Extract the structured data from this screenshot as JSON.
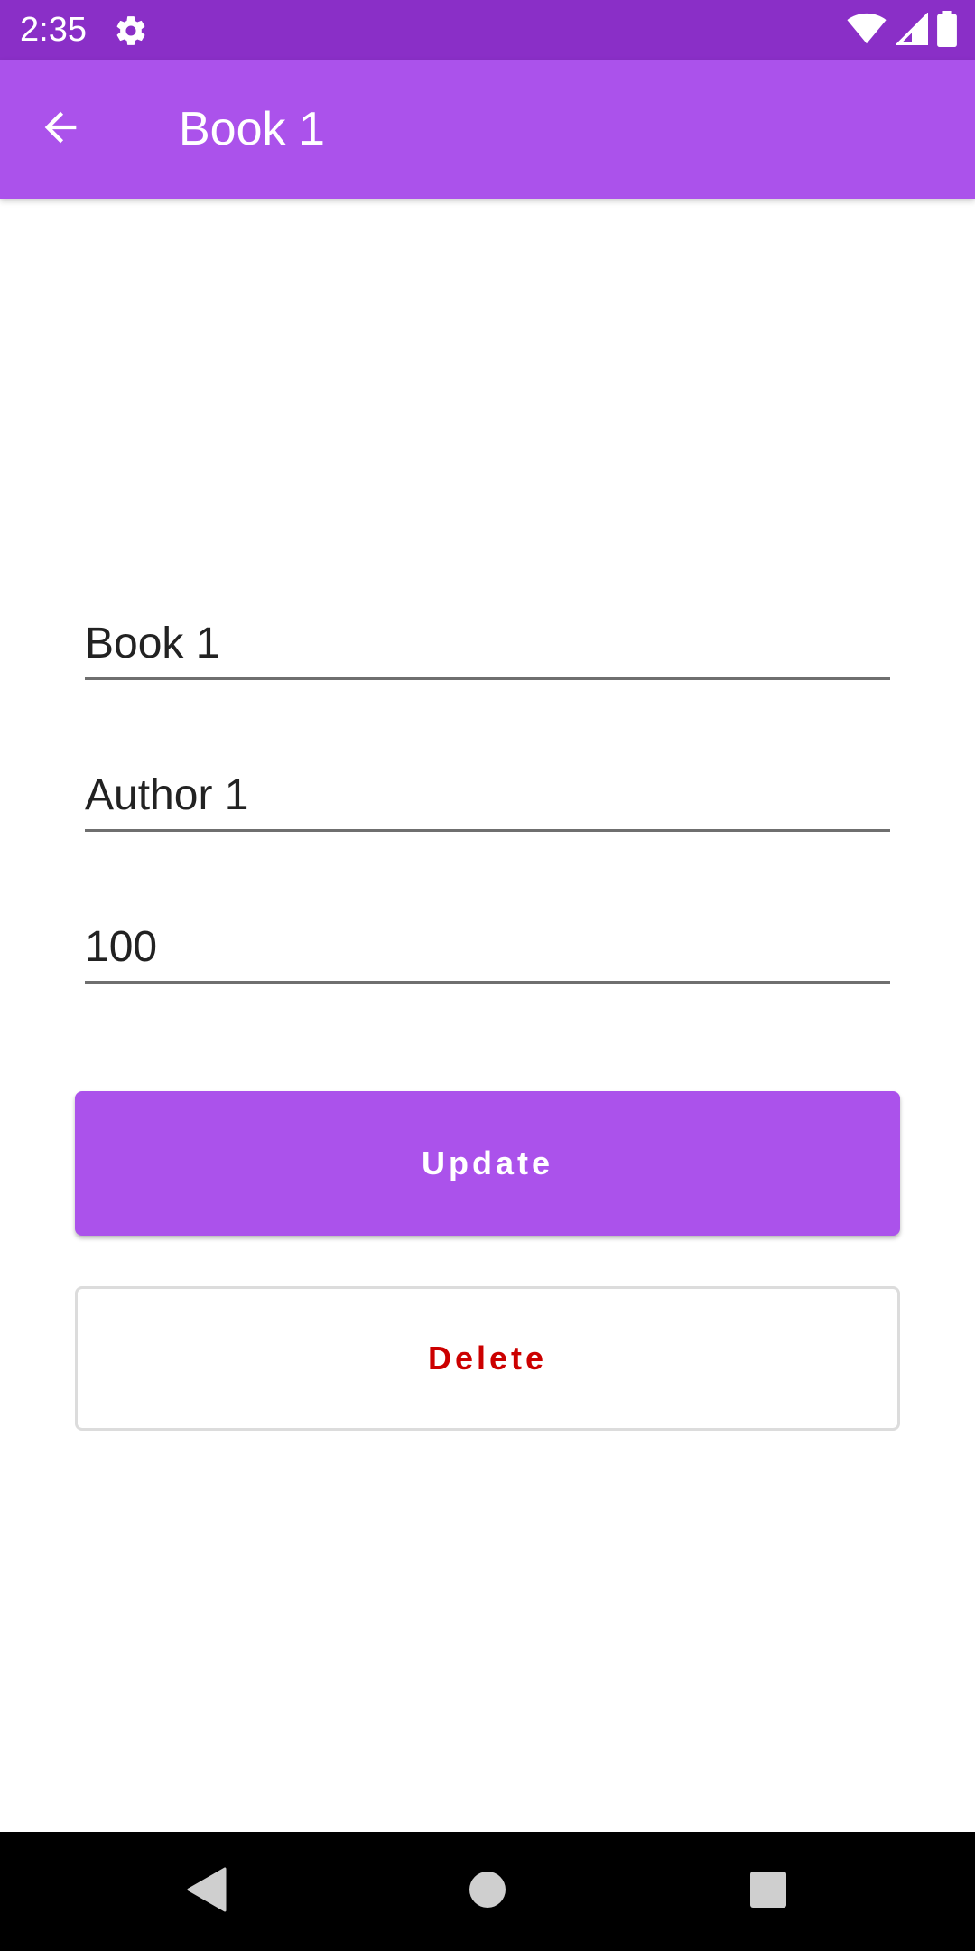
{
  "status_bar": {
    "time": "2:35",
    "icons": [
      "settings-gear-icon",
      "wifi-icon",
      "cellular-signal-icon",
      "battery-icon"
    ]
  },
  "app_bar": {
    "title": "Book 1",
    "back_icon": "arrow-left-icon"
  },
  "form": {
    "title_value": "Book 1",
    "author_value": "Author 1",
    "price_value": "100"
  },
  "actions": {
    "update_label": "Update",
    "delete_label": "Delete"
  },
  "nav_bar": {
    "icons": [
      "nav-back-triangle-icon",
      "nav-home-circle-icon",
      "nav-recents-square-icon"
    ]
  },
  "colors": {
    "status_bar": "#8a2fc7",
    "app_bar": "#ab52eb",
    "primary_button": "#ab52eb",
    "delete_text": "#cc0000"
  }
}
